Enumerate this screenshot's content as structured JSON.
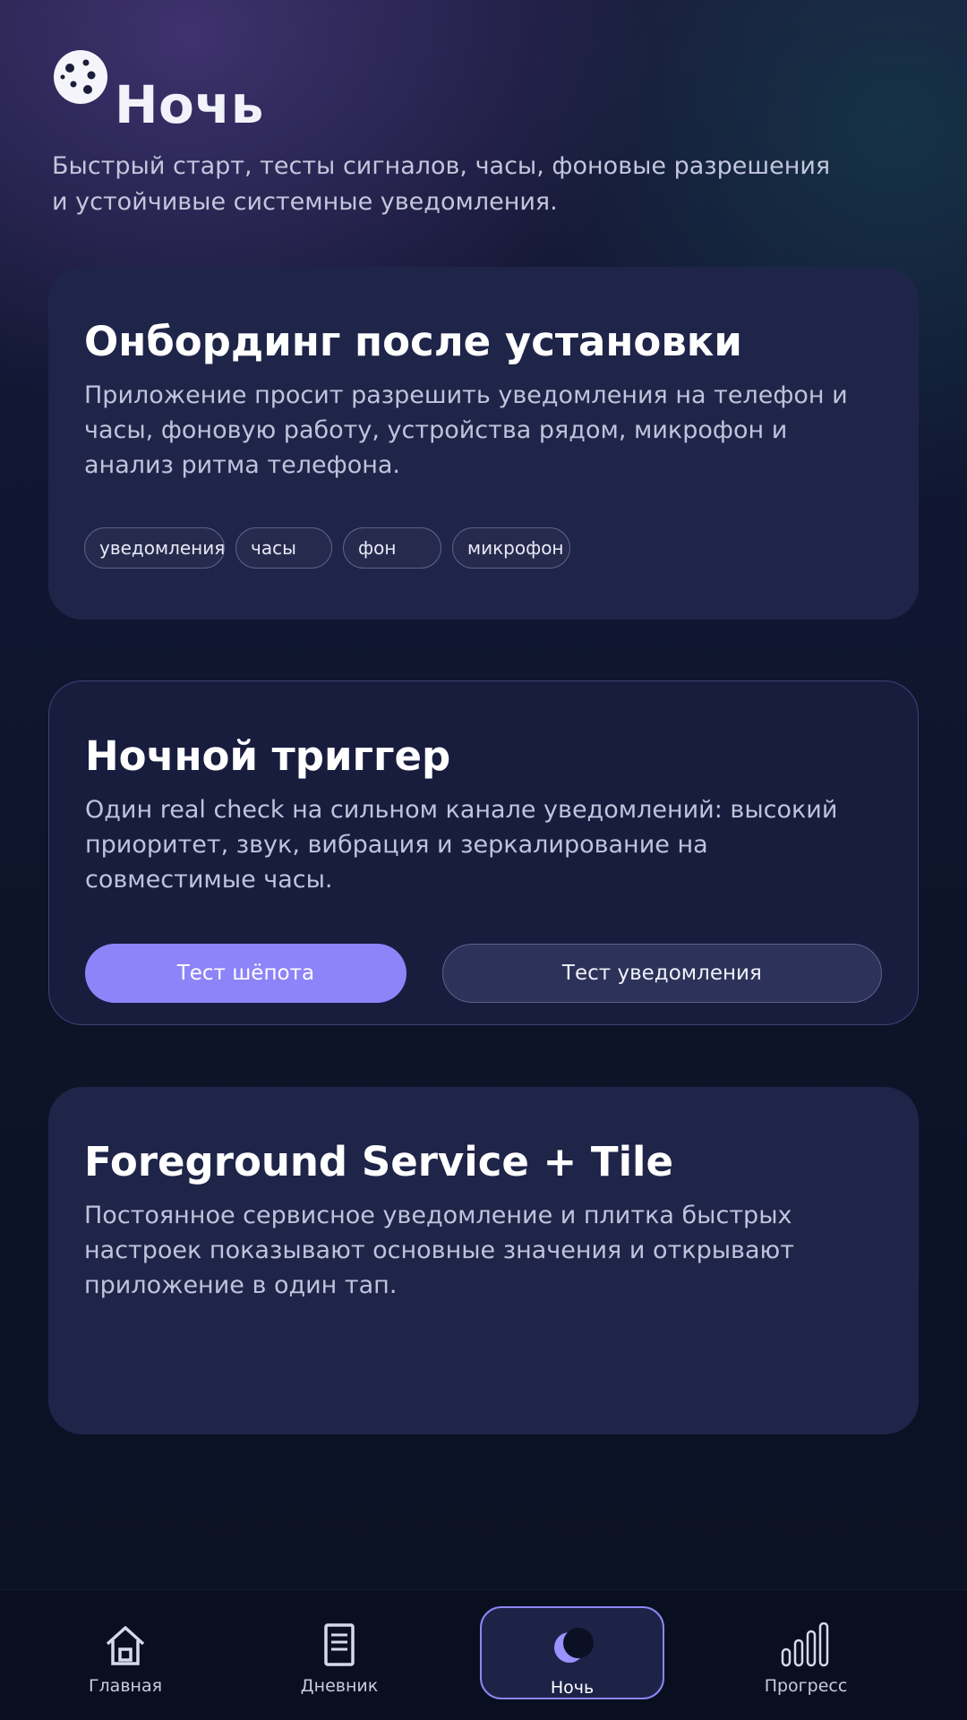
{
  "header": {
    "title": "Ночь",
    "subtitle": "Быстрый старт, тесты сигналов, часы, фоновые разрешения и устойчивые системные уведомления."
  },
  "cards": {
    "onboarding": {
      "title": "Онбординг после установки",
      "body": "Приложение просит разрешить уведомления на телефон и часы, фоновую работу, устройства рядом, микрофон и анализ ритма телефона.",
      "chips": [
        "уведомления",
        "часы",
        "фон",
        "микрофон"
      ]
    },
    "trigger": {
      "title": "Ночной триггер",
      "body": "Один real check на сильном канале уведомлений: высокий приоритет, звук, вибрация и зеркалирование на совместимые часы.",
      "primary_button": "Тест шёпота",
      "secondary_button": "Тест уведомления"
    },
    "service": {
      "title": "Foreground Service + Tile",
      "body": "Постоянное сервисное уведомление и плитка быстрых настроек показывают основные значения и открывают приложение в один тап."
    }
  },
  "nav": {
    "items": [
      {
        "label": "Главная",
        "icon": "home-icon"
      },
      {
        "label": "Дневник",
        "icon": "diary-icon"
      },
      {
        "label": "Ночь",
        "icon": "moon-icon",
        "active": true
      },
      {
        "label": "Прогресс",
        "icon": "progress-bars-icon"
      }
    ]
  },
  "colors": {
    "accent": "#8d84f9",
    "card": "#1f2549",
    "background": "#0b1123"
  }
}
